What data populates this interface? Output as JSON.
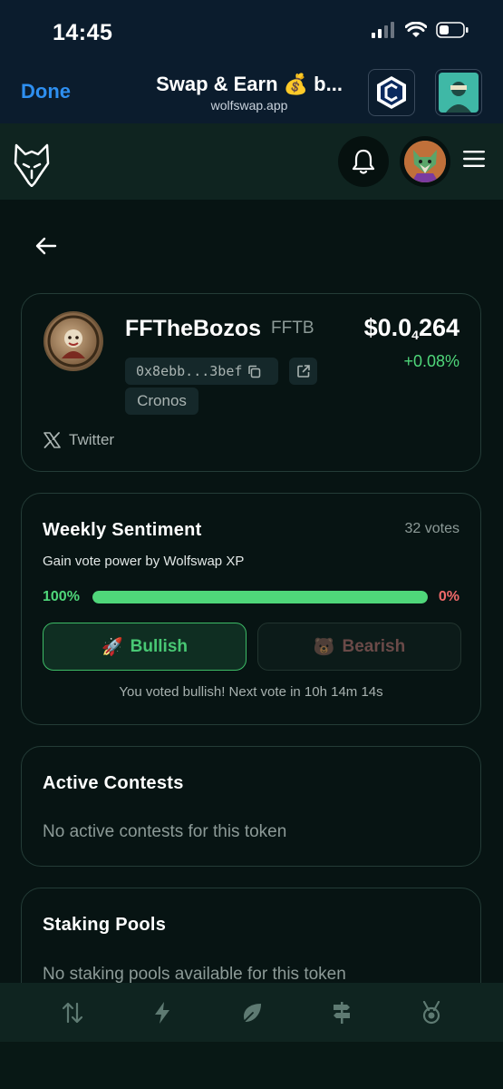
{
  "status_bar": {
    "time": "14:45"
  },
  "browser": {
    "done_label": "Done",
    "title": "Swap & Earn 💰 b...",
    "domain": "wolfswap.app"
  },
  "token": {
    "name": "FFTheBozos",
    "symbol": "FFTB",
    "price_prefix": "$0.0",
    "price_subscript": "4",
    "price_suffix": "264",
    "change": "+0.08%",
    "address": "0x8ebb...3bef",
    "chain": "Cronos",
    "twitter_label": "Twitter"
  },
  "sentiment": {
    "title": "Weekly Sentiment",
    "votes": "32 votes",
    "subtitle": "Gain vote power by Wolfswap XP",
    "bullish_pct_label": "100%",
    "bearish_pct_label": "0%",
    "bullish_fraction": 1.0,
    "bullish_label": "Bullish",
    "bearish_label": "Bearish",
    "bullish_emoji": "🚀",
    "bearish_emoji": "🐻",
    "note": "You voted bullish! Next vote in 10h 14m 14s",
    "colors": {
      "bull": "#4fd77a",
      "bear": "#f06a6a"
    }
  },
  "contests": {
    "title": "Active Contests",
    "empty": "No active contests for this token"
  },
  "staking": {
    "title": "Staking Pools",
    "empty": "No staking pools available for this token"
  },
  "nav": {
    "items": [
      "swap-icon",
      "lightning-icon",
      "leaf-icon",
      "signpost-icon",
      "medal-icon"
    ]
  }
}
